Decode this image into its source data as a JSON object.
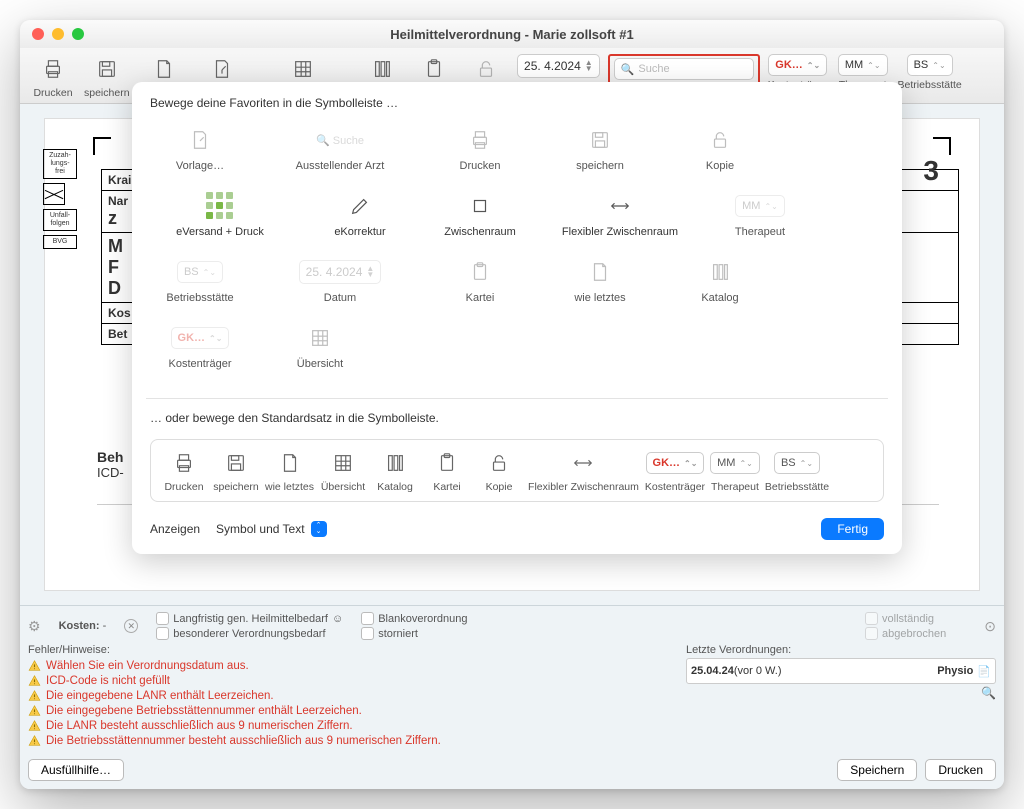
{
  "window": {
    "title": "Heilmittelverordnung -  Marie zollsoft #1"
  },
  "toolbar": {
    "items": [
      {
        "id": "drucken",
        "label": "Drucken"
      },
      {
        "id": "speichern",
        "label": "speichern"
      },
      {
        "id": "wie-letztes",
        "label": "wie letztes"
      },
      {
        "id": "vorlage",
        "label": "Vorlage…"
      },
      {
        "id": "uebersicht",
        "label": "Übersicht"
      },
      {
        "id": "katalog",
        "label": "Katalog"
      },
      {
        "id": "kartei",
        "label": "Kartei"
      },
      {
        "id": "kopie",
        "label": "Kopie"
      }
    ],
    "date": {
      "value": "25. 4.2024",
      "label": "Datum"
    },
    "search": {
      "placeholder": "Suche",
      "label": "Ausstellender Arzt"
    },
    "kostentraeger": {
      "value": "GK…",
      "label": "Kostenträger"
    },
    "therapeut": {
      "value": "MM",
      "label": "Therapeut"
    },
    "betriebsstaette": {
      "value": "BS",
      "label": "Betriebsstätte"
    }
  },
  "modal": {
    "intro": "Bewege deine Favoriten in die Symbolleiste …",
    "favorites": [
      {
        "id": "vorlage",
        "label": "Vorlage…",
        "dim": true
      },
      {
        "id": "ausst-arzt",
        "label": "Ausstellender Arzt",
        "dim": true,
        "type": "search",
        "placeholder": "Suche"
      },
      {
        "id": "drucken",
        "label": "Drucken",
        "dim": true
      },
      {
        "id": "speichern",
        "label": "speichern",
        "dim": true
      },
      {
        "id": "kopie",
        "label": "Kopie",
        "dim": true
      },
      {
        "id": "eversand",
        "label": "eVersand + Druck",
        "enabled": true,
        "type": "eversand"
      },
      {
        "id": "ekorrektur",
        "label": "eKorrektur",
        "enabled": true,
        "type": "pencil"
      },
      {
        "id": "zwischenraum",
        "label": "Zwischenraum",
        "enabled": true,
        "type": "box"
      },
      {
        "id": "flex-zwischen",
        "label": "Flexibler Zwischenraum",
        "enabled": true,
        "type": "flex"
      },
      {
        "id": "therapeut",
        "label": "Therapeut",
        "dim": true,
        "type": "pill",
        "value": "MM"
      },
      {
        "id": "betriebs",
        "label": "Betriebsstätte",
        "dim": true,
        "type": "pill",
        "value": "BS"
      },
      {
        "id": "datum",
        "label": "Datum",
        "dim": true,
        "type": "date",
        "value": "25. 4.2024"
      },
      {
        "id": "kartei",
        "label": "Kartei",
        "dim": true
      },
      {
        "id": "wie-letztes",
        "label": "wie letztes",
        "dim": true
      },
      {
        "id": "katalog",
        "label": "Katalog",
        "dim": true
      },
      {
        "id": "kostentraeger",
        "label": "Kostenträger",
        "dim": true,
        "type": "pill",
        "value": "GK…",
        "red": true
      },
      {
        "id": "uebersicht",
        "label": "Übersicht",
        "dim": true
      }
    ],
    "default_intro": "… oder bewege den Standardsatz in die Symbolleiste.",
    "defaults": [
      {
        "id": "drucken",
        "label": "Drucken"
      },
      {
        "id": "speichern",
        "label": "speichern"
      },
      {
        "id": "wie-letztes",
        "label": "wie letztes"
      },
      {
        "id": "uebersicht",
        "label": "Übersicht"
      },
      {
        "id": "katalog",
        "label": "Katalog"
      },
      {
        "id": "kartei",
        "label": "Kartei"
      },
      {
        "id": "kopie",
        "label": "Kopie"
      },
      {
        "id": "flex",
        "label": "Flexibler Zwischenraum"
      },
      {
        "id": "kost",
        "label": "Kostenträger",
        "type": "pill",
        "value": "GK…",
        "red": true
      },
      {
        "id": "ther",
        "label": "Therapeut",
        "type": "pill",
        "value": "MM"
      },
      {
        "id": "betr",
        "label": "Betriebsstätte",
        "type": "pill",
        "value": "BS"
      }
    ],
    "show_label": "Anzeigen",
    "show_mode": "Symbol und Text",
    "done": "Fertig"
  },
  "doc": {
    "tags": [
      "Zuzah-lungs-frei",
      "",
      "Unfall-folgen",
      "BVG"
    ],
    "rows": [
      "Krai",
      "Nar",
      "z",
      "M",
      "F",
      "D",
      "Kos",
      "Bet"
    ],
    "beh1": "Beh",
    "beh2": "ICD-",
    "num": "3"
  },
  "footer": {
    "kosten_label": "Kosten:",
    "kosten_value": "-",
    "chk": [
      {
        "label": "Langfristig gen. Heilmittelbedarf",
        "extra": "☺"
      },
      {
        "label": "besonderer Verordnungsbedarf"
      },
      {
        "label": "Blankoverordnung"
      },
      {
        "label": "storniert"
      },
      {
        "label": "vollständig",
        "dim": true
      },
      {
        "label": "abgebrochen",
        "dim": true
      }
    ],
    "errors_title": "Fehler/Hinweise:",
    "errors": [
      "Wählen Sie ein Verordnungsdatum aus.",
      "ICD-Code is nicht gefüllt",
      "Die eingegebene LANR enthält Leerzeichen.",
      "Die eingegebene Betriebsstättennummer enthält Leerzeichen.",
      "Die LANR besteht ausschließlich aus 9 numerischen Ziffern.",
      "Die Betriebsstättennummer besteht ausschließlich aus 9 numerischen Ziffern."
    ],
    "last_title": "Letzte Verordnungen:",
    "last": {
      "date": "25.04.24",
      "info": "(vor 0 W.)",
      "badge": "Physio"
    },
    "help": "Ausfüllhilfe…",
    "save": "Speichern",
    "print": "Drucken"
  }
}
